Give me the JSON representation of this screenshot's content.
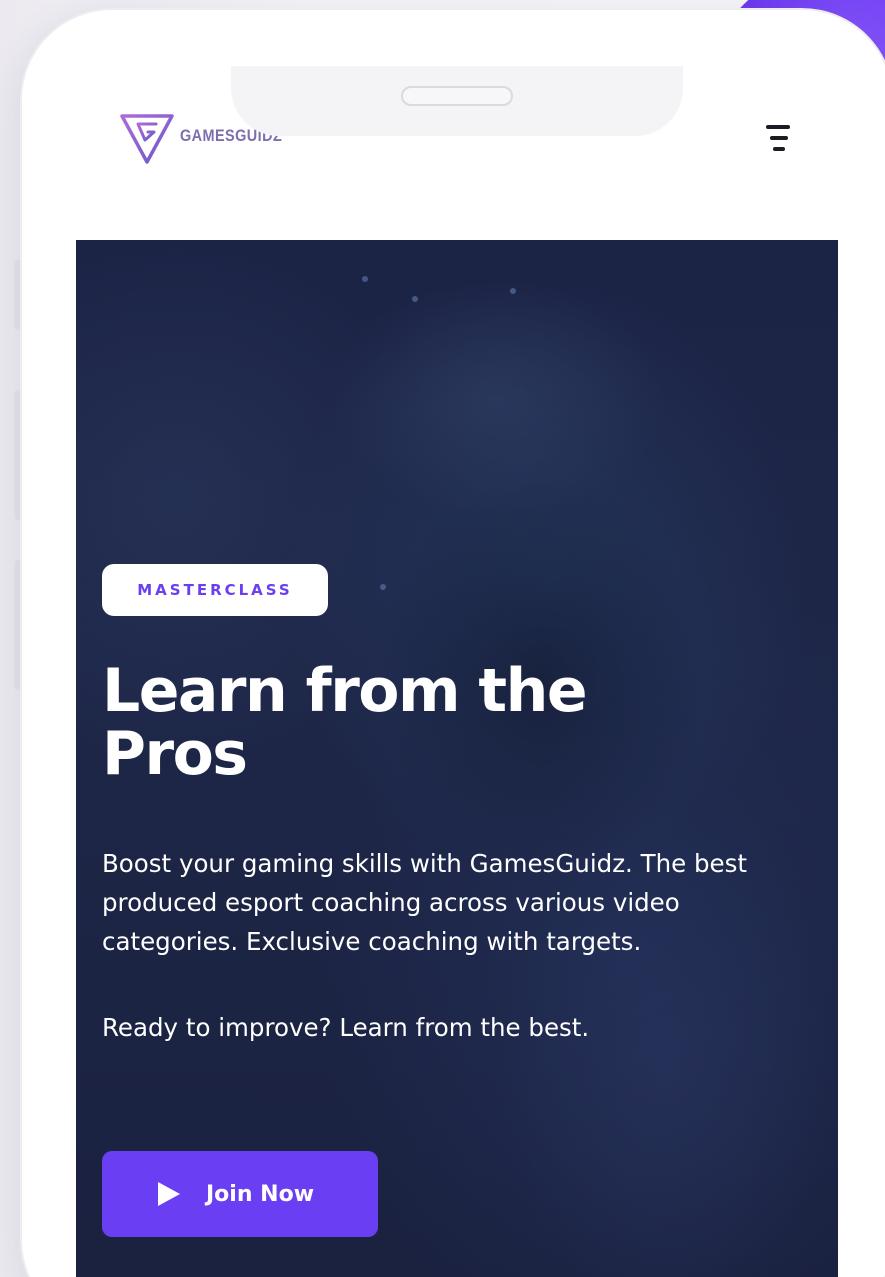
{
  "brand": {
    "name": "GAMESGUIDZ",
    "accent_color": "#6a3ff3",
    "logo_color": "#7d6fae"
  },
  "header": {
    "menu_icon": "hamburger-menu-icon"
  },
  "hero": {
    "badge": "MASTERCLASS",
    "headline_line1": "Learn from the",
    "headline_line2": "Pros",
    "paragraph_1": "Boost your gaming skills with GamesGuidz. The best produced esport coaching across various video categories. Exclusive coaching with targets.",
    "paragraph_2": "Ready to improve? Learn from the best.",
    "cta_label": "Join Now",
    "cta_icon": "play-icon",
    "background_color": "#1c2446"
  }
}
